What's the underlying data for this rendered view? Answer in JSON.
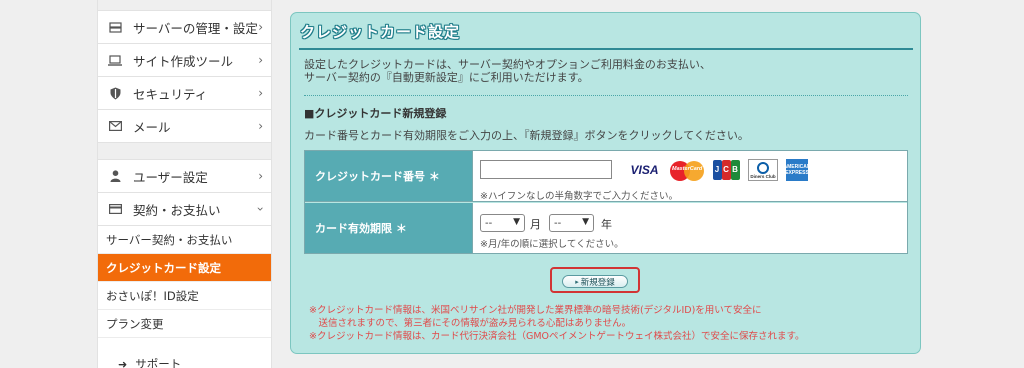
{
  "sidebar": {
    "main_items": [
      {
        "label": "サーバーの管理・設定",
        "icon": "server-icon"
      },
      {
        "label": "サイト作成ツール",
        "icon": "laptop-icon"
      },
      {
        "label": "セキュリティ",
        "icon": "shield-icon"
      },
      {
        "label": "メール",
        "icon": "mail-icon"
      }
    ],
    "user_items": [
      {
        "label": "ユーザー設定",
        "icon": "user-icon"
      },
      {
        "label": "契約・お支払い",
        "icon": "credit-card-icon"
      }
    ],
    "sub_items": [
      {
        "label": "サーバー契約・お支払い"
      },
      {
        "label": "クレジットカード設定"
      },
      {
        "label": "おさいぽ！ID設定"
      },
      {
        "label": "プラン変更"
      }
    ],
    "support_label": "サポート",
    "colors": {
      "active": "#f26b0a"
    }
  },
  "main": {
    "title": "クレジットカード設定",
    "intro_line1": "設定したクレジットカードは、サーバー契約やオプションご利用料金のお支払い、",
    "intro_line2": "サーバー契約の『自動更新設定』にご利用いただけます。",
    "section_head": "■クレジットカード新規登録",
    "section_desc": "カード番号とカード有効期限をご入力の上、『新規登録』ボタンをクリックしてください。",
    "form": {
      "card_number_label": "クレジットカード番号 ＊",
      "card_number_value": "",
      "card_number_note": "※ハイフンなしの半角数字でご入力ください。",
      "brands": [
        "VISA",
        "MasterCard",
        "JCB",
        "Diners Club",
        "AMERICAN EXPRESS"
      ],
      "expiry_label": "カード有効期限 ＊",
      "month_value": "--",
      "month_unit": "月",
      "year_value": "--",
      "year_unit": "年",
      "expiry_note": "※月/年の順に選択してください。"
    },
    "submit_label": "新規登録",
    "warnings": [
      "※クレジットカード情報は、米国ベリサイン社が開発した業界標準の暗号技術(デジタルID)を用いて安全に",
      "　送信されますので、第三者にその情報が盗み見られる心配はありません。",
      "※クレジットカード情報は、カード代行決済会社（GMOペイメントゲートウェイ株式会社）で安全に保存されます。"
    ],
    "colors": {
      "panel": "#b8e6e2",
      "header_cell": "#57abb3",
      "warning": "#e04a4a"
    }
  }
}
